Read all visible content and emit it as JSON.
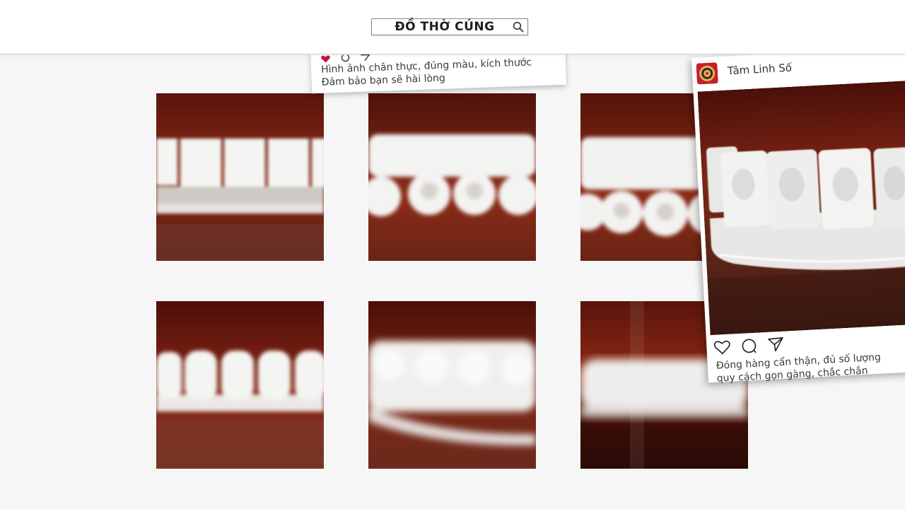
{
  "header": {
    "search_text": "ĐỒ THỜ CÚNG",
    "search_icon": "search-icon"
  },
  "grid": {
    "photos": [
      {
        "subject": "frosted glass offering cups on red wood"
      },
      {
        "subject": "frosted glass cups set on tray"
      },
      {
        "subject": "frosted glass cups row"
      },
      {
        "subject": "frosted glass cups front view"
      },
      {
        "subject": "frosted glass cups blurred"
      },
      {
        "subject": "frosted glass cups blurred row"
      }
    ]
  },
  "post_top": {
    "icons": [
      "heart-icon",
      "comment-icon",
      "share-icon"
    ],
    "caption_line1": "Hình ảnh chân thực, đúng màu, kích thước",
    "caption_line2": "Đảm bảo bạn sẽ hài lòng"
  },
  "post_right": {
    "account_name": "Tâm Linh Số",
    "icons": [
      "heart-icon",
      "comment-icon",
      "share-icon"
    ],
    "caption_line1": "Đóng hàng cẩn thận, đủ số lượng",
    "caption_line2": "quy cách gọn gàng, chắc chắn"
  },
  "colors": {
    "wood": "#7a2414",
    "wood_dark": "#4a0f08",
    "glass": "#f1f1ef",
    "accent_red": "#c2183a"
  }
}
